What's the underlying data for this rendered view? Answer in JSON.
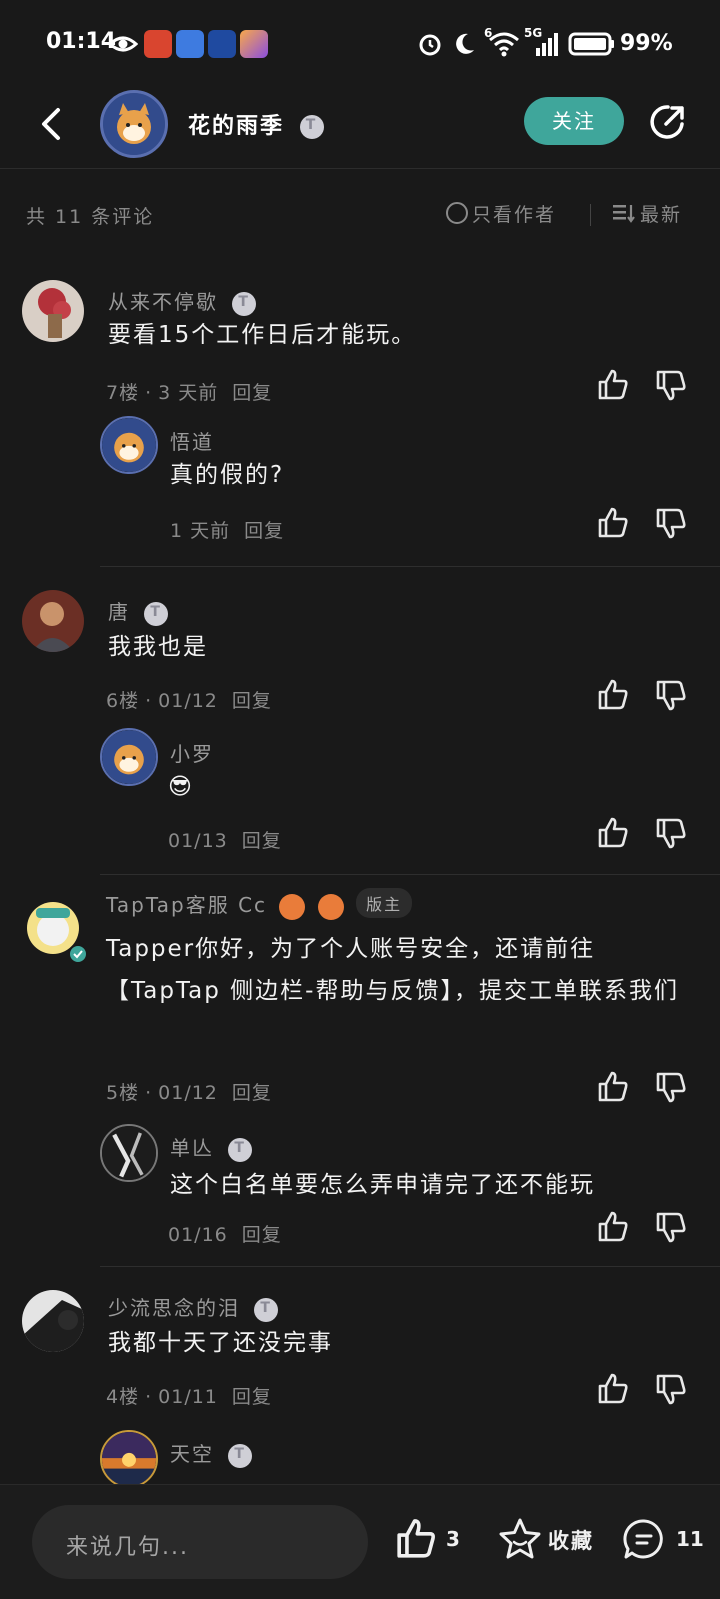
{
  "status_bar": {
    "time": "01:14",
    "battery": "99%",
    "network": "5G",
    "signal_prefix": "6"
  },
  "header": {
    "title": "花的雨季",
    "follow_label": "关注"
  },
  "sort_bar": {
    "count_label": "共 11 条评论",
    "author_only_label": "只看作者",
    "sort_label": "最新"
  },
  "comments": [
    {
      "username": "从来不停歇",
      "text": "要看15个工作日后才能玩。",
      "floor": "7楼",
      "time": "3 天前",
      "reply_label": "回复",
      "reply": {
        "username": "悟道",
        "text": "真的假的?",
        "time": "1 天前",
        "reply_label": "回复"
      }
    },
    {
      "username": "唐",
      "text": "我我也是",
      "floor": "6楼",
      "time": "01/12",
      "reply_label": "回复",
      "reply": {
        "username": "小罗",
        "text": "😎",
        "time": "01/13",
        "reply_label": "回复"
      }
    },
    {
      "username": "TapTap客服 Cc",
      "host_badge": "版主",
      "text": "Tapper你好，为了个人账号安全，还请前往【TapTap 侧边栏-帮助与反馈】，提交工单联系我们",
      "floor": "5楼",
      "time": "01/12",
      "reply_label": "回复",
      "reply": {
        "username": "单亾",
        "text": "这个白名单要怎么弄申请完了还不能玩",
        "time": "01/16",
        "reply_label": "回复"
      }
    },
    {
      "username": "少流思念的泪",
      "text": "我都十天了还没完事",
      "floor": "4楼",
      "time": "01/11",
      "reply_label": "回复",
      "reply": {
        "username": "天空"
      }
    }
  ],
  "bottom_bar": {
    "input_placeholder": "来说几句...",
    "like_count": "3",
    "favorite_label": "收藏",
    "comment_count": "11"
  },
  "colors": {
    "background": "#191919",
    "accent": "#3fa69b",
    "muted_text": "#8a8a8a"
  }
}
